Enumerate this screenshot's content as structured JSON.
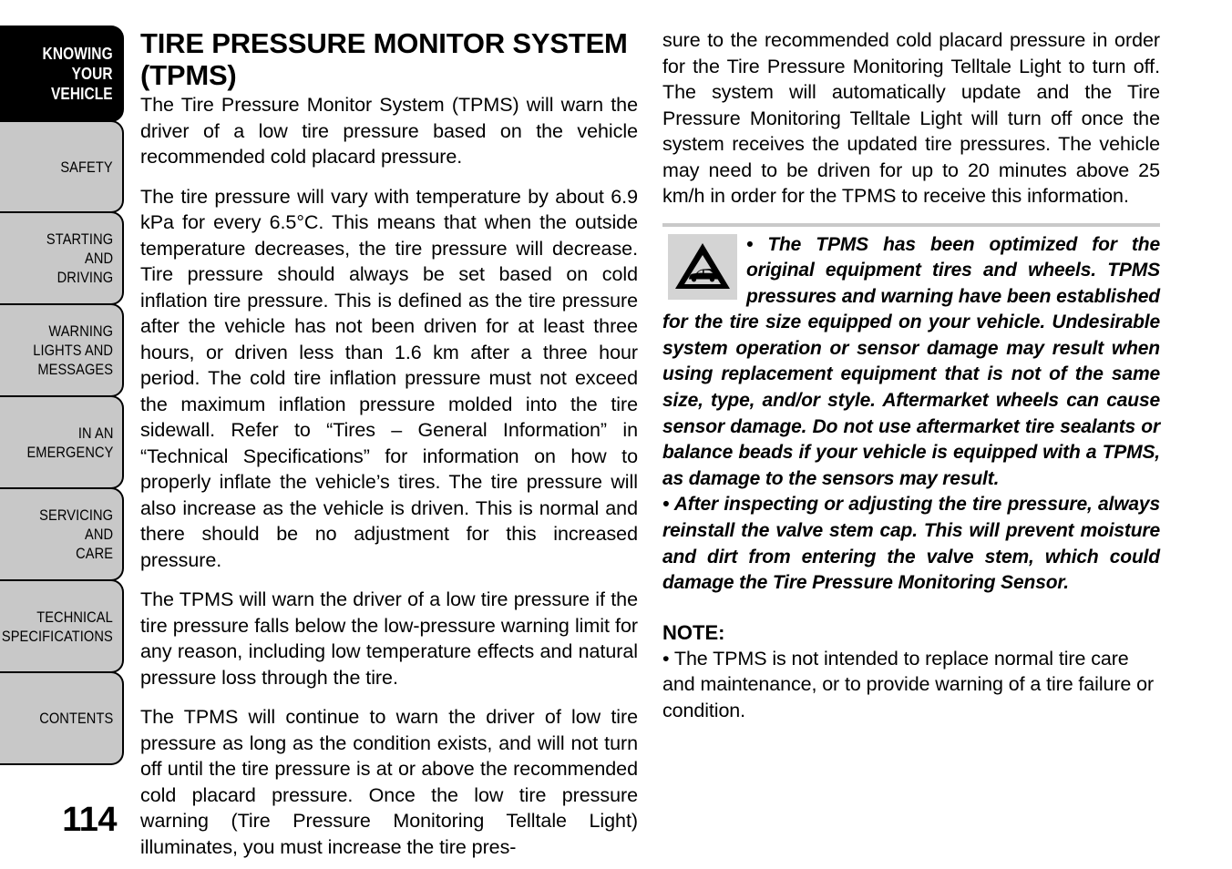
{
  "page": {
    "number": "114"
  },
  "sidebar": {
    "items": [
      {
        "label": "KNOWING\nYOUR\nVEHICLE",
        "active": true
      },
      {
        "label": "SAFETY",
        "active": false
      },
      {
        "label": "STARTING\nAND\nDRIVING",
        "active": false
      },
      {
        "label": "WARNING\nLIGHTS AND\nMESSAGES",
        "active": false
      },
      {
        "label": "IN AN\nEMERGENCY",
        "active": false
      },
      {
        "label": "SERVICING\nAND\nCARE",
        "active": false
      },
      {
        "label": "TECHNICAL\nSPECIFICATIONS",
        "active": false
      },
      {
        "label": "CONTENTS",
        "active": false
      }
    ]
  },
  "left_column": {
    "title": "TIRE PRESSURE MONITOR SYSTEM (TPMS)",
    "paragraphs": [
      "The Tire Pressure Monitor System (TPMS) will warn the driver of a low tire pressure based on the vehicle recommended cold placard pressure.",
      "The tire pressure will vary with temperature by about 6.9 kPa for every 6.5°C. This means that when the outside temperature decreases, the tire pressure will decrease. Tire pressure should always be set based on cold inflation tire pressure. This is defined as the tire pressure after the vehicle has not been driven for at least three hours, or driven less than 1.6 km after a three hour period. The cold tire inflation pressure must not exceed the maximum inflation pressure molded into the tire sidewall. Refer to “Tires – General Information” in “Technical Specifications” for information on how to properly inflate the vehicle’s tires. The tire pressure will also increase as the vehicle is driven. This is normal and there should be no adjustment for this increased pressure.",
      "The TPMS will warn the driver of a low tire pressure if the tire pressure falls below the low-pressure warning limit for any reason, including low temperature effects and natural pressure loss through the tire.",
      "The TPMS will continue to warn the driver of low tire pressure as long as the condition exists, and will not turn off until the tire pressure is at or above the recommended cold placard pressure. Once the low tire pressure warning (Tire Pressure Monitoring Telltale Light) illuminates, you must increase the tire pres-"
    ]
  },
  "right_column": {
    "continued_paragraph": "sure to the recommended cold placard pressure in order for the Tire Pressure Monitoring Telltale Light to turn off. The system will automatically update and the Tire Pressure Monitoring Telltale Light will turn off once the system receives the updated tire pressures. The vehicle may need to be driven for up to 20 minutes above 25 km/h in order for the TPMS to receive this information.",
    "warning": {
      "icon_name": "warning-triangle-car-icon",
      "icon_background_color": "#d4d4d4",
      "rule_color": "#c9c9c9",
      "bullets": [
        "•  The TPMS has been optimized for the original equipment tires and wheels. TPMS pressures and warning have been established for the tire size equipped on your vehicle. Undesirable system operation or sensor damage may result when using replacement equipment that is not of the same size, type, and/or style. Aftermarket wheels can cause sensor damage. Do not use aftermarket tire sealants or balance beads if your vehicle is equipped with a TPMS, as damage to the sensors may result.",
        "•  After inspecting or adjusting the tire pressure, always reinstall the valve stem cap. This will prevent moisture and dirt from entering the valve stem, which could damage the Tire Pressure Monitoring Sensor."
      ]
    },
    "note": {
      "title": "NOTE:",
      "body": "•  The TPMS is not intended to replace normal tire care and maintenance, or to provide warning of a tire failure or condition."
    }
  }
}
